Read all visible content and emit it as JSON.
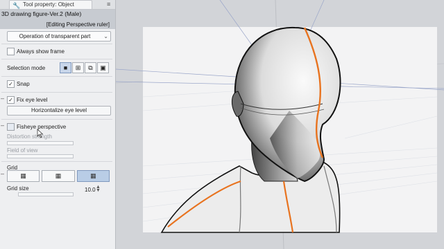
{
  "tab": {
    "icon": "wrench-icon",
    "label": "Tool property: Object",
    "menu_icon": "panel-menu-icon"
  },
  "subtool": {
    "name": "3D drawing figure-Ver.2 (Male)",
    "mode": "[Editing Perspective ruler]"
  },
  "operation": {
    "value": "Operation of transparent part"
  },
  "always_show_frame": {
    "label": "Always show frame",
    "checked": false
  },
  "selection_mode": {
    "label": "Selection mode",
    "buttons": [
      "select-all-mode-icon",
      "add-selection-icon",
      "copy-selection-icon",
      "fit-selection-icon"
    ],
    "active_index": 0
  },
  "snap": {
    "label": "Snap",
    "checked": true,
    "mark": "✓"
  },
  "fix_eye_level": {
    "label": "Fix eye level",
    "checked": true,
    "mark": "✓"
  },
  "horizontalize": {
    "label": "Horizontalize eye level"
  },
  "fisheye": {
    "label": "Fisheye perspective",
    "checked": false
  },
  "distortion_strength": {
    "label": "Distortion strength"
  },
  "field_of_view": {
    "label": "Field of view"
  },
  "grid": {
    "label": "Grid",
    "buttons": [
      "grid-xy-icon",
      "grid-yz-icon",
      "grid-xz-icon"
    ],
    "active_index": 2
  },
  "grid_size": {
    "label": "Grid size",
    "value": "10.0",
    "spin": "◇"
  },
  "colors": {
    "panel_bg": "#eeeff1",
    "accent_blue": "#b9cde6",
    "ruler_line": "#e8731f",
    "canvas_bg": "#f3f3f4"
  }
}
